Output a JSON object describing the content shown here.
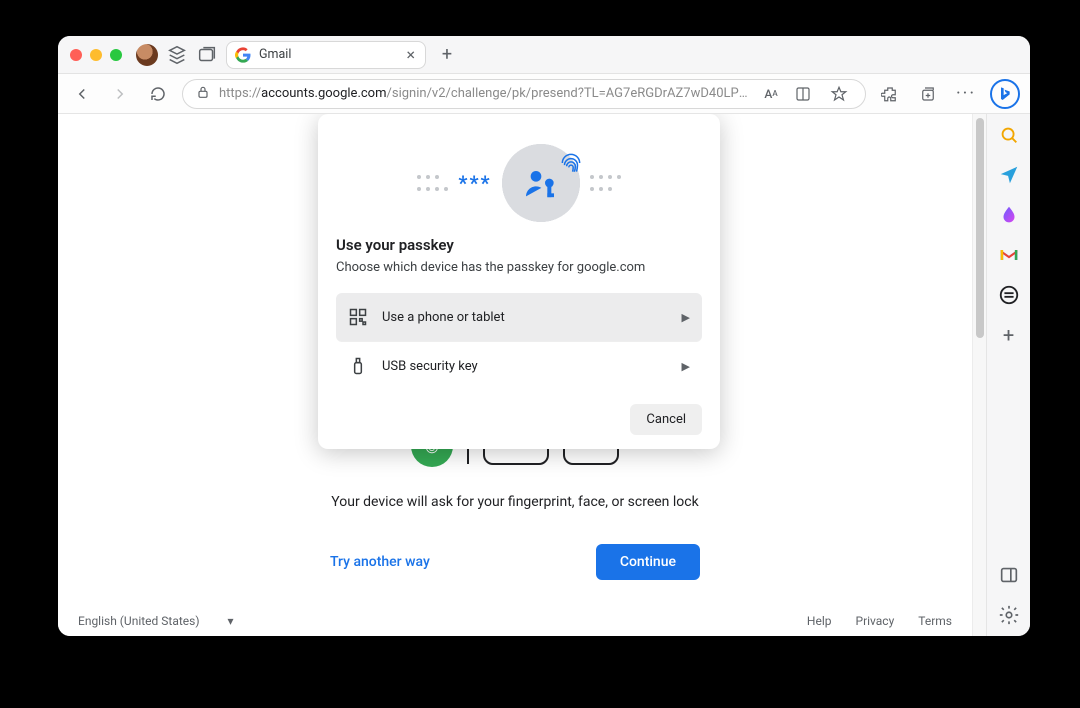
{
  "tab": {
    "title": "Gmail"
  },
  "url": {
    "prefix": "https://",
    "domain": "accounts.google.com",
    "path": "/signin/v2/challenge/pk/presend?TL=AG7eRGDrAZ7wD40LPvW…"
  },
  "dialog": {
    "title": "Use your passkey",
    "subtitle": "Choose which device has the passkey for google.com",
    "options": [
      {
        "label": "Use a phone or tablet"
      },
      {
        "label": "USB security key"
      }
    ],
    "cancel_label": "Cancel"
  },
  "page": {
    "instruction": "Your device will ask for your fingerprint, face, or screen lock",
    "try_another": "Try another way",
    "continue_label": "Continue"
  },
  "footer": {
    "language": "English (United States)",
    "help": "Help",
    "privacy": "Privacy",
    "terms": "Terms"
  }
}
